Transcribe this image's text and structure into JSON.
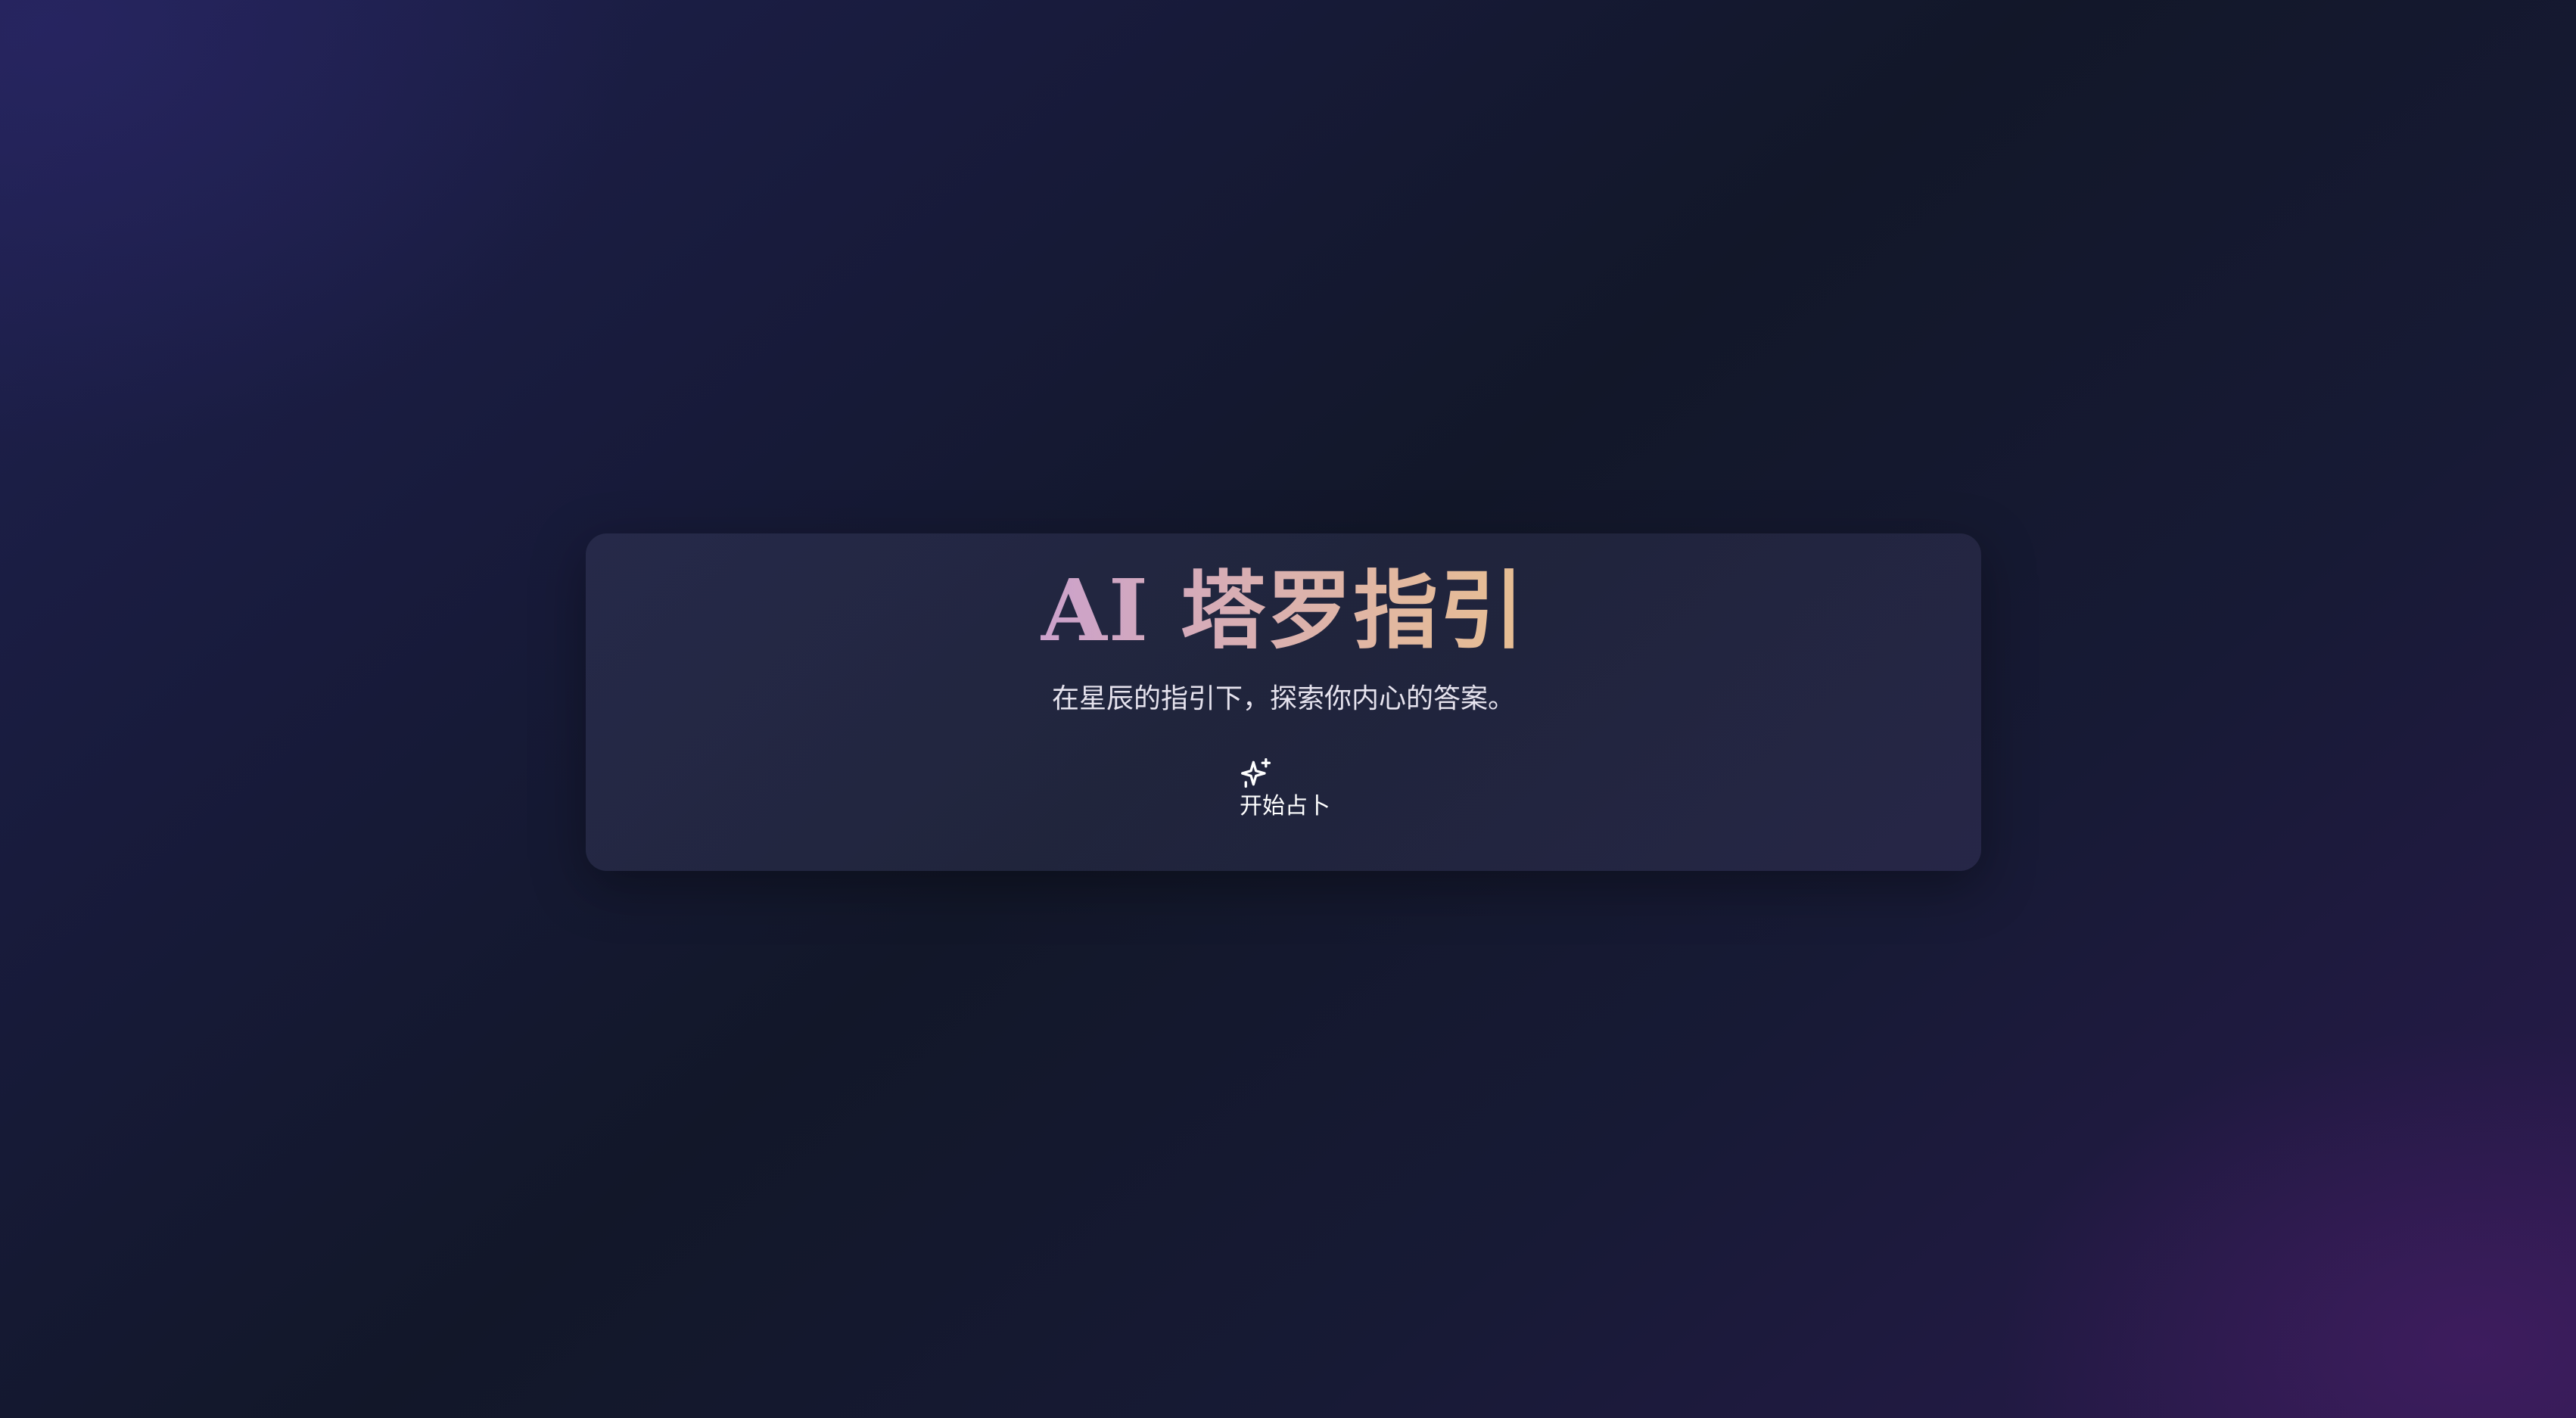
{
  "hero": {
    "title": "AI 塔罗指引",
    "subtitle": "在星辰的指引下，探索你内心的答案。"
  },
  "start_button": {
    "label": "开始占卜",
    "icon": "sparkles-icon"
  },
  "colors": {
    "title_gradient_start": "#b07fe8",
    "title_gradient_end": "#f3d070",
    "background_dark": "#121729",
    "background_accent": "#2a1a4e"
  }
}
